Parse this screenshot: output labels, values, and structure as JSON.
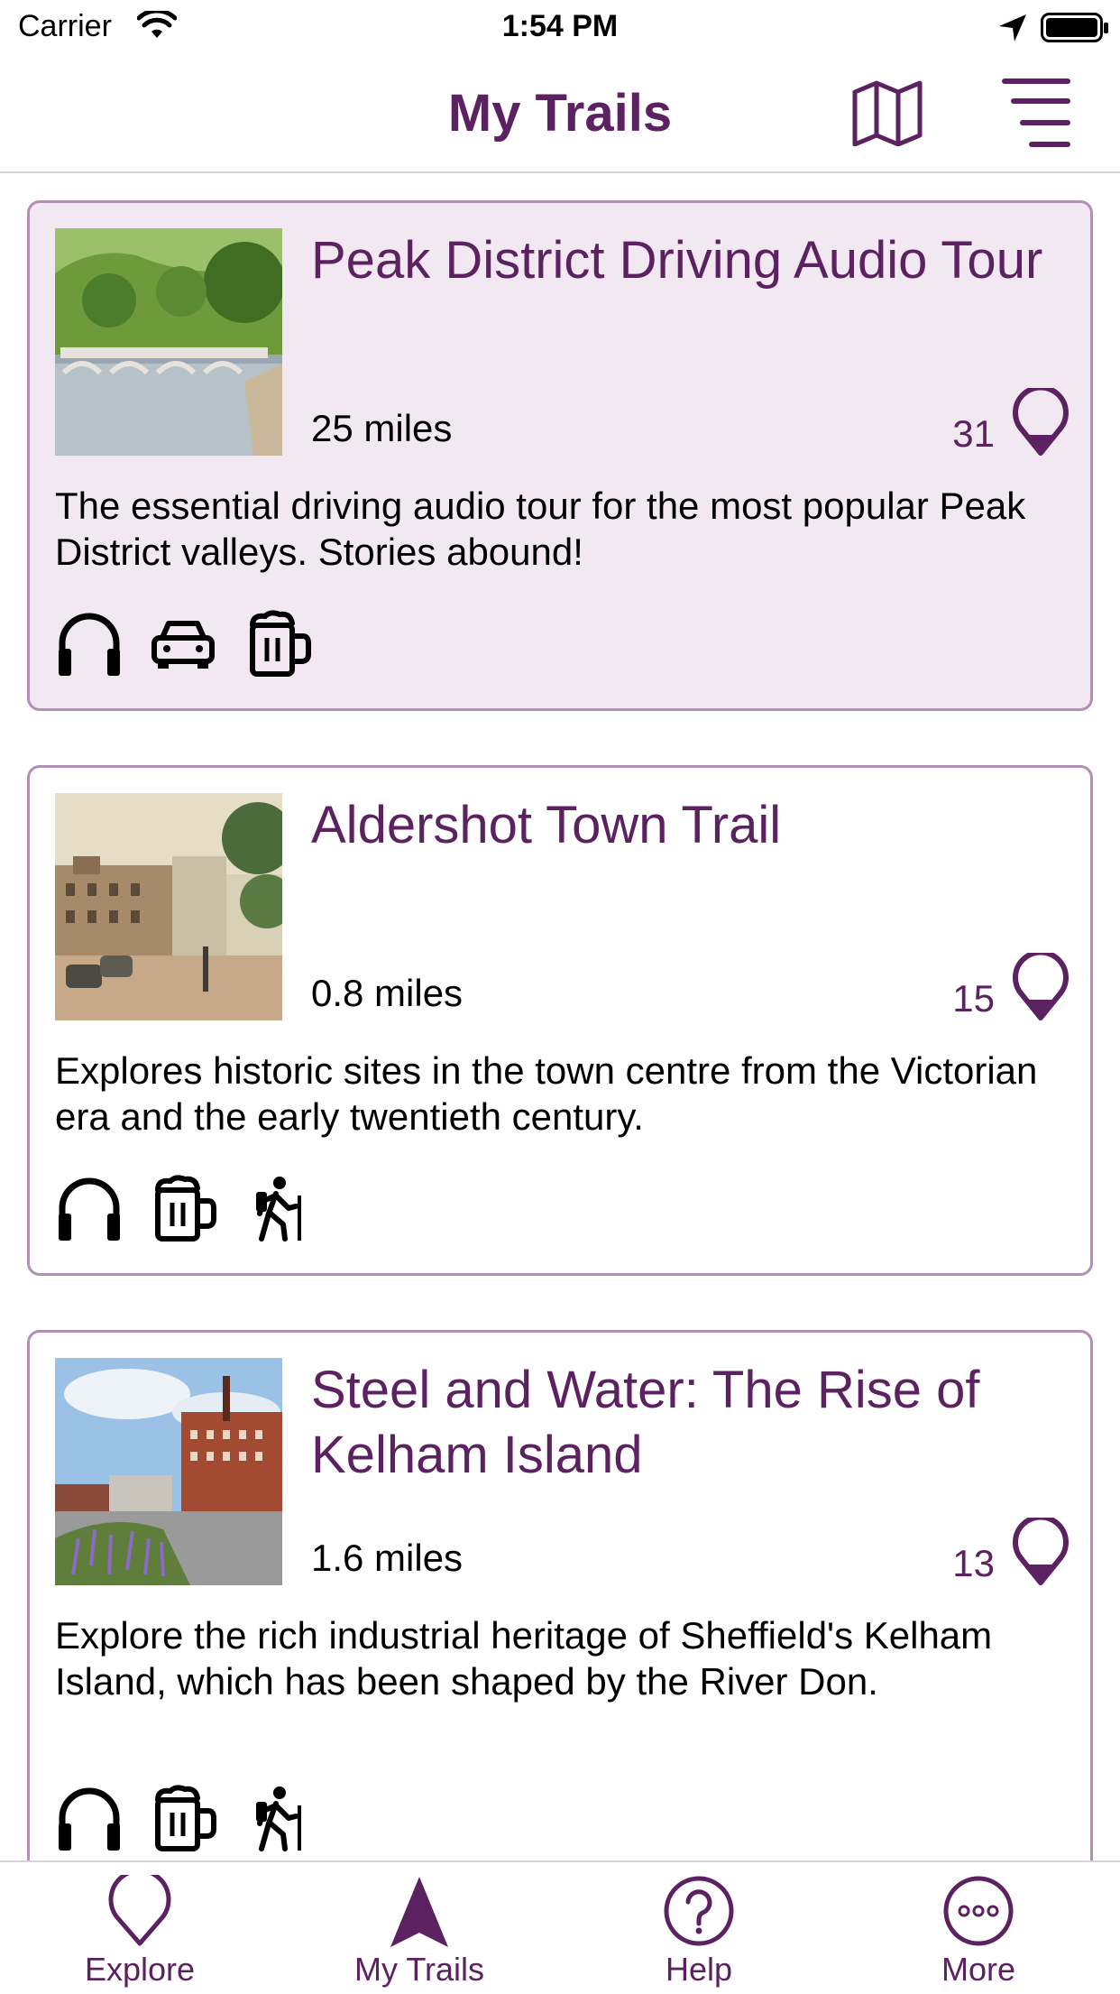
{
  "status_bar": {
    "carrier": "Carrier",
    "time": "1:54 PM"
  },
  "header": {
    "title": "My Trails"
  },
  "colors": {
    "accent": "#5c2160",
    "card_border": "#b28fb5",
    "highlight_bg": "#f2e8f2"
  },
  "trails": [
    {
      "name": "Peak District Driving Audio Tour",
      "distance": "25 miles",
      "stops": "31",
      "description": "The essential driving audio tour for the most popular Peak District valleys. Stories abound!",
      "features": [
        "headphones-icon",
        "car-icon",
        "beer-mug-icon"
      ]
    },
    {
      "name": "Aldershot Town Trail",
      "distance": "0.8 miles",
      "stops": "15",
      "description": "Explores historic sites in the town centre from the Victorian era and the early twentieth century.",
      "features": [
        "headphones-icon",
        "beer-mug-icon",
        "hiker-icon"
      ]
    },
    {
      "name": "Steel and Water: The Rise of Kelham Island",
      "distance": "1.6 miles",
      "stops": "13",
      "description": "Explore the rich industrial heritage of Sheffield's Kelham Island, which has been shaped by the River Don.",
      "features": [
        "headphones-icon",
        "beer-mug-icon",
        "hiker-icon"
      ]
    }
  ],
  "tab_bar": {
    "items": [
      {
        "label": "Explore",
        "icon": "pin-outline-icon"
      },
      {
        "label": "My Trails",
        "icon": "navigation-arrow-icon",
        "selected": true
      },
      {
        "label": "Help",
        "icon": "question-circle-icon"
      },
      {
        "label": "More",
        "icon": "ellipsis-circle-icon"
      }
    ]
  }
}
